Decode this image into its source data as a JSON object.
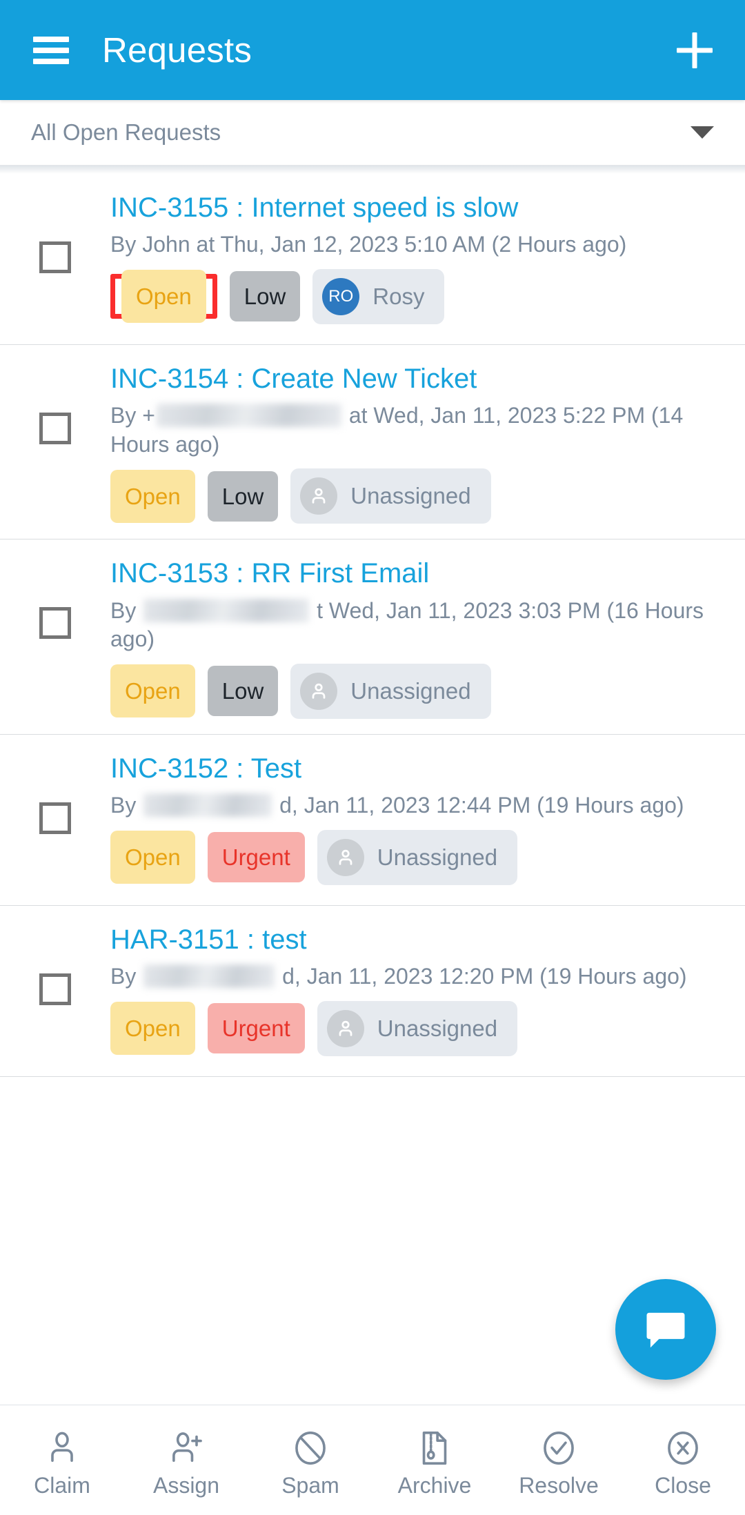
{
  "appbar": {
    "menu_icon": "hamburger-icon",
    "title": "Requests",
    "add_icon": "plus-icon"
  },
  "filter": {
    "selected": "All Open Requests",
    "caret_icon": "chevron-down-icon"
  },
  "colors": {
    "brand_blue": "#14A0DC",
    "link_blue": "#17A2DC",
    "status_open_bg": "#FBE5A0",
    "status_open_text": "#E8A313",
    "priority_low_bg": "#B9BDC1",
    "priority_low_text": "#1D242B",
    "priority_urgent_bg": "#F8AFAB",
    "priority_urgent_text": "#E8342A",
    "assignee_chip_bg": "#E6EAEF",
    "avatar_blue": "#2D79C0",
    "meta_text": "#7B8A9B",
    "highlight_ring": "#FA2D2D"
  },
  "requests": [
    {
      "title": "INC-3155 : Internet speed is slow",
      "meta_prefix": "By John at Thu, Jan 12, 2023 5:10 AM (2 Hours ago)",
      "redacted": false,
      "status": "Open",
      "status_highlighted": true,
      "priority": "Low",
      "priority_type": "low",
      "assignee": "Rosy",
      "assignee_initials": "RO",
      "assigned": true
    },
    {
      "title": "INC-3154 : Create New Ticket",
      "meta_prefix": "By +",
      "meta_suffix": "at Wed, Jan 11, 2023 5:22 PM (14 Hours ago)",
      "redacted": true,
      "redact_width": 268,
      "status": "Open",
      "status_highlighted": false,
      "priority": "Low",
      "priority_type": "low",
      "assignee": "Unassigned",
      "assignee_initials": "",
      "assigned": false
    },
    {
      "title": "INC-3153 : RR First Email",
      "meta_prefix": "By ",
      "meta_suffix": "t Wed, Jan 11, 2023 3:03 PM (16 Hours ago)",
      "redacted": true,
      "redact_width": 240,
      "status": "Open",
      "status_highlighted": false,
      "priority": "Low",
      "priority_type": "low",
      "assignee": "Unassigned",
      "assignee_initials": "",
      "assigned": false
    },
    {
      "title": "INC-3152 : Test",
      "meta_prefix": "By ",
      "meta_suffix": "d, Jan 11, 2023 12:44 PM (19 Hours ago)",
      "redacted": true,
      "redact_width": 186,
      "status": "Open",
      "status_highlighted": false,
      "priority": "Urgent",
      "priority_type": "urgent",
      "assignee": "Unassigned",
      "assignee_initials": "",
      "assigned": false
    },
    {
      "title": "HAR-3151 : test",
      "meta_prefix": "By ",
      "meta_suffix": "d, Jan 11, 2023 12:20 PM (19 Hours ago)",
      "redacted": true,
      "redact_width": 190,
      "status": "Open",
      "status_highlighted": false,
      "priority": "Urgent",
      "priority_type": "urgent",
      "assignee": "Unassigned",
      "assignee_initials": "",
      "assigned": false
    }
  ],
  "fab": {
    "icon": "chat-bubble-icon"
  },
  "bottombar": {
    "items": [
      {
        "label": "Claim",
        "icon": "person-icon"
      },
      {
        "label": "Assign",
        "icon": "person-add-icon"
      },
      {
        "label": "Spam",
        "icon": "ban-icon"
      },
      {
        "label": "Archive",
        "icon": "archive-file-icon"
      },
      {
        "label": "Resolve",
        "icon": "check-circle-icon"
      },
      {
        "label": "Close",
        "icon": "x-circle-icon"
      }
    ]
  }
}
